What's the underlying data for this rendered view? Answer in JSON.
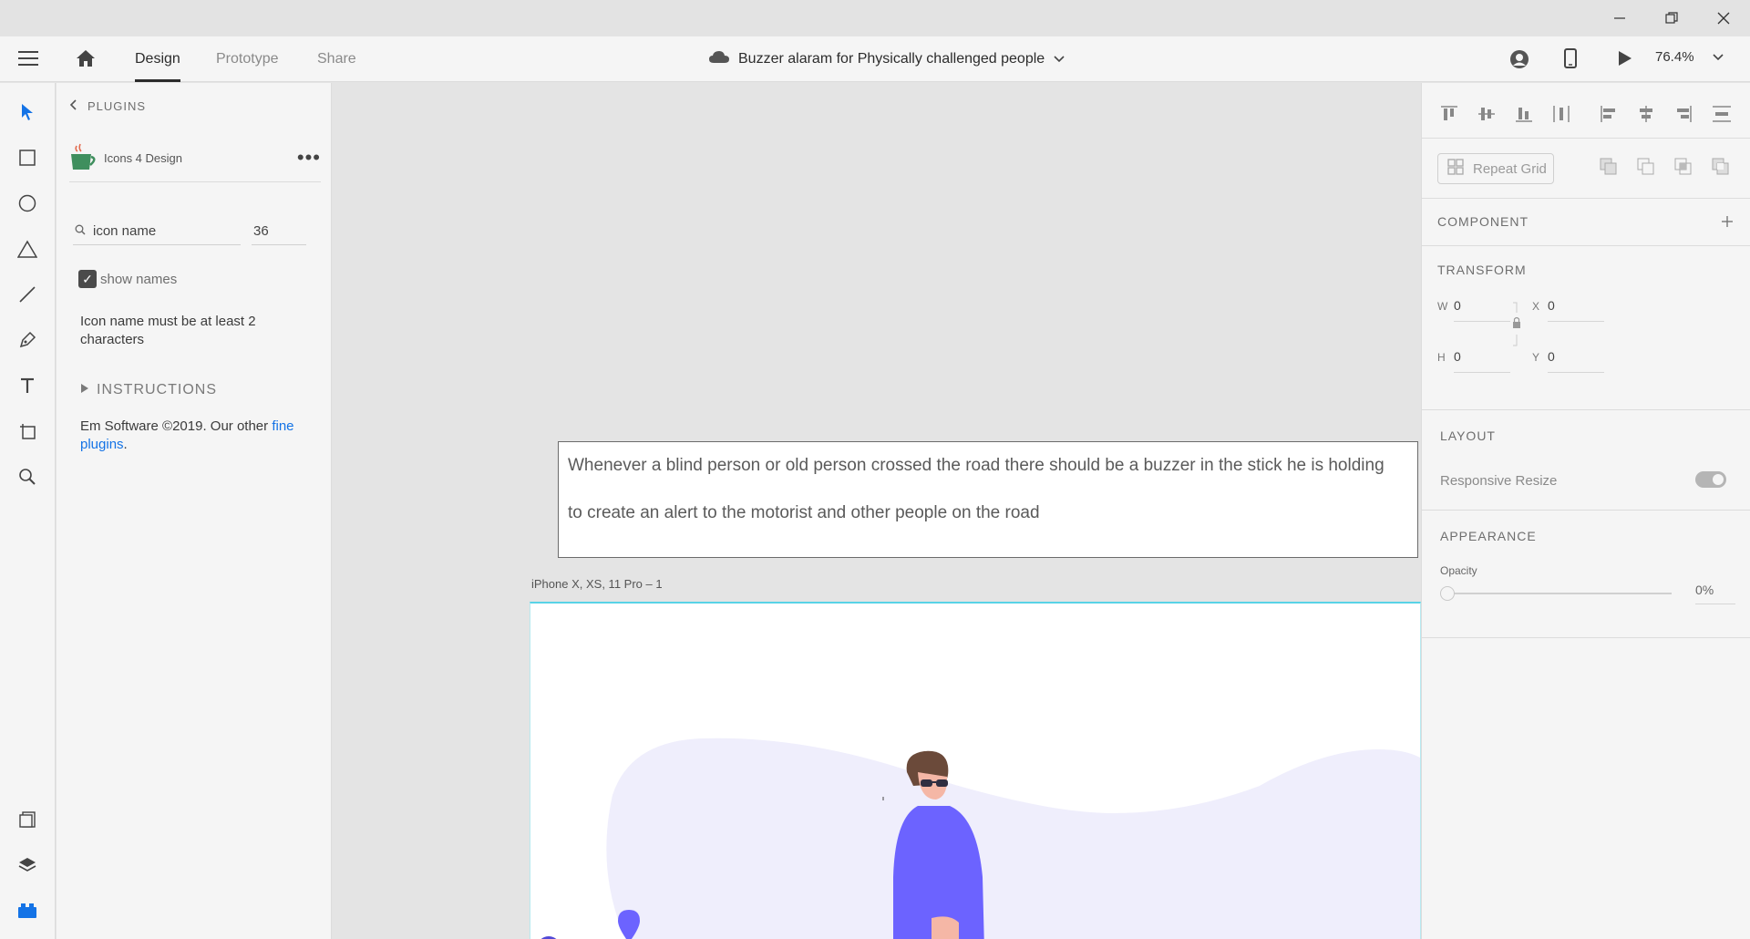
{
  "window": {
    "minimize_icon": "minimize-icon",
    "restore_icon": "restore-icon",
    "close_icon": "close-icon"
  },
  "toolbar": {
    "tabs": [
      {
        "label": "Design",
        "active": true
      },
      {
        "label": "Prototype",
        "active": false
      },
      {
        "label": "Share",
        "active": false
      }
    ],
    "document_title": "Buzzer alaram for Physically challenged people",
    "zoom": "76.4%"
  },
  "tools": [
    "select-tool",
    "rectangle-tool",
    "ellipse-tool",
    "polygon-tool",
    "line-tool",
    "pen-tool",
    "text-tool",
    "artboard-tool",
    "zoom-tool",
    "assets",
    "layers",
    "plugins"
  ],
  "plugins_panel": {
    "header": "PLUGINS",
    "plugin_name": "Icons 4 Design",
    "search_placeholder": "icon name",
    "size_value": "36",
    "show_names_label": "show names",
    "show_names_checked": true,
    "validation_message": "Icon name must be at least 2 characters",
    "instructions_label": "INSTRUCTIONS",
    "credit_text": "Em Software ©2019. Our other ",
    "credit_link": "fine plugins",
    "credit_end": "."
  },
  "canvas": {
    "note_line_1": "Whenever a blind person or old person crossed the road there should be a buzzer in the stick he is holding",
    "note_line_2": "to create an alert to the motorist and other people on the road",
    "artboard_label": "iPhone X, XS, 11 Pro – 1"
  },
  "properties": {
    "repeat_grid_label": "Repeat Grid",
    "component_label": "COMPONENT",
    "transform_label": "TRANSFORM",
    "w_label": "W",
    "w_value": "0",
    "x_label": "X",
    "x_value": "0",
    "h_label": "H",
    "h_value": "0",
    "y_label": "Y",
    "y_value": "0",
    "layout_label": "LAYOUT",
    "responsive_resize_label": "Responsive Resize",
    "responsive_resize_on": false,
    "appearance_label": "APPEARANCE",
    "opacity_label": "Opacity",
    "opacity_value": "0%"
  },
  "colors": {
    "accent": "#1473e6",
    "illustration_purple": "#6c63ff",
    "illustration_lavender": "#efeefc",
    "artboard_border": "#58d3e6"
  }
}
